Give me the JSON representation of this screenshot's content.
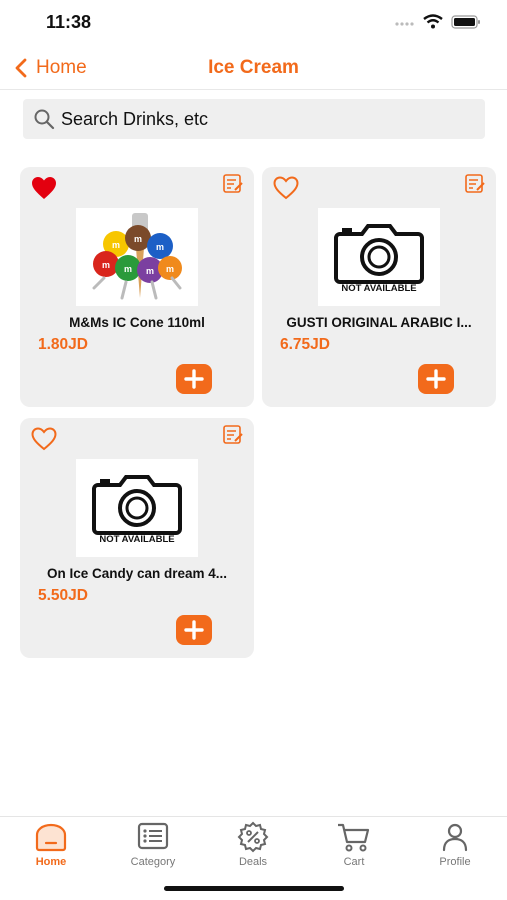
{
  "status_bar": {
    "time": "11:38"
  },
  "nav": {
    "back_label": "Home",
    "title": "Ice Cream"
  },
  "search": {
    "placeholder": "Search Drinks, etc"
  },
  "products": [
    {
      "name": "M&Ms IC Cone 110ml",
      "price": "1.80JD",
      "favorite": true,
      "image": "product-photo"
    },
    {
      "name": "GUSTI ORIGINAL ARABIC I...",
      "price": "6.75JD",
      "favorite": false,
      "image": "not-available"
    },
    {
      "name": "On Ice Candy can dream  4...",
      "price": "5.50JD",
      "favorite": false,
      "image": "not-available"
    }
  ],
  "not_available_label": "NOT AVAILABLE",
  "tabs": [
    {
      "label": "Home",
      "icon": "home-icon",
      "active": true
    },
    {
      "label": "Category",
      "icon": "category-icon",
      "active": false
    },
    {
      "label": "Deals",
      "icon": "deals-icon",
      "active": false
    },
    {
      "label": "Cart",
      "icon": "cart-icon",
      "active": false
    },
    {
      "label": "Profile",
      "icon": "profile-icon",
      "active": false
    }
  ],
  "colors": {
    "accent": "#f26a1b",
    "card_bg": "#efefef",
    "heart": "#e3000f"
  }
}
